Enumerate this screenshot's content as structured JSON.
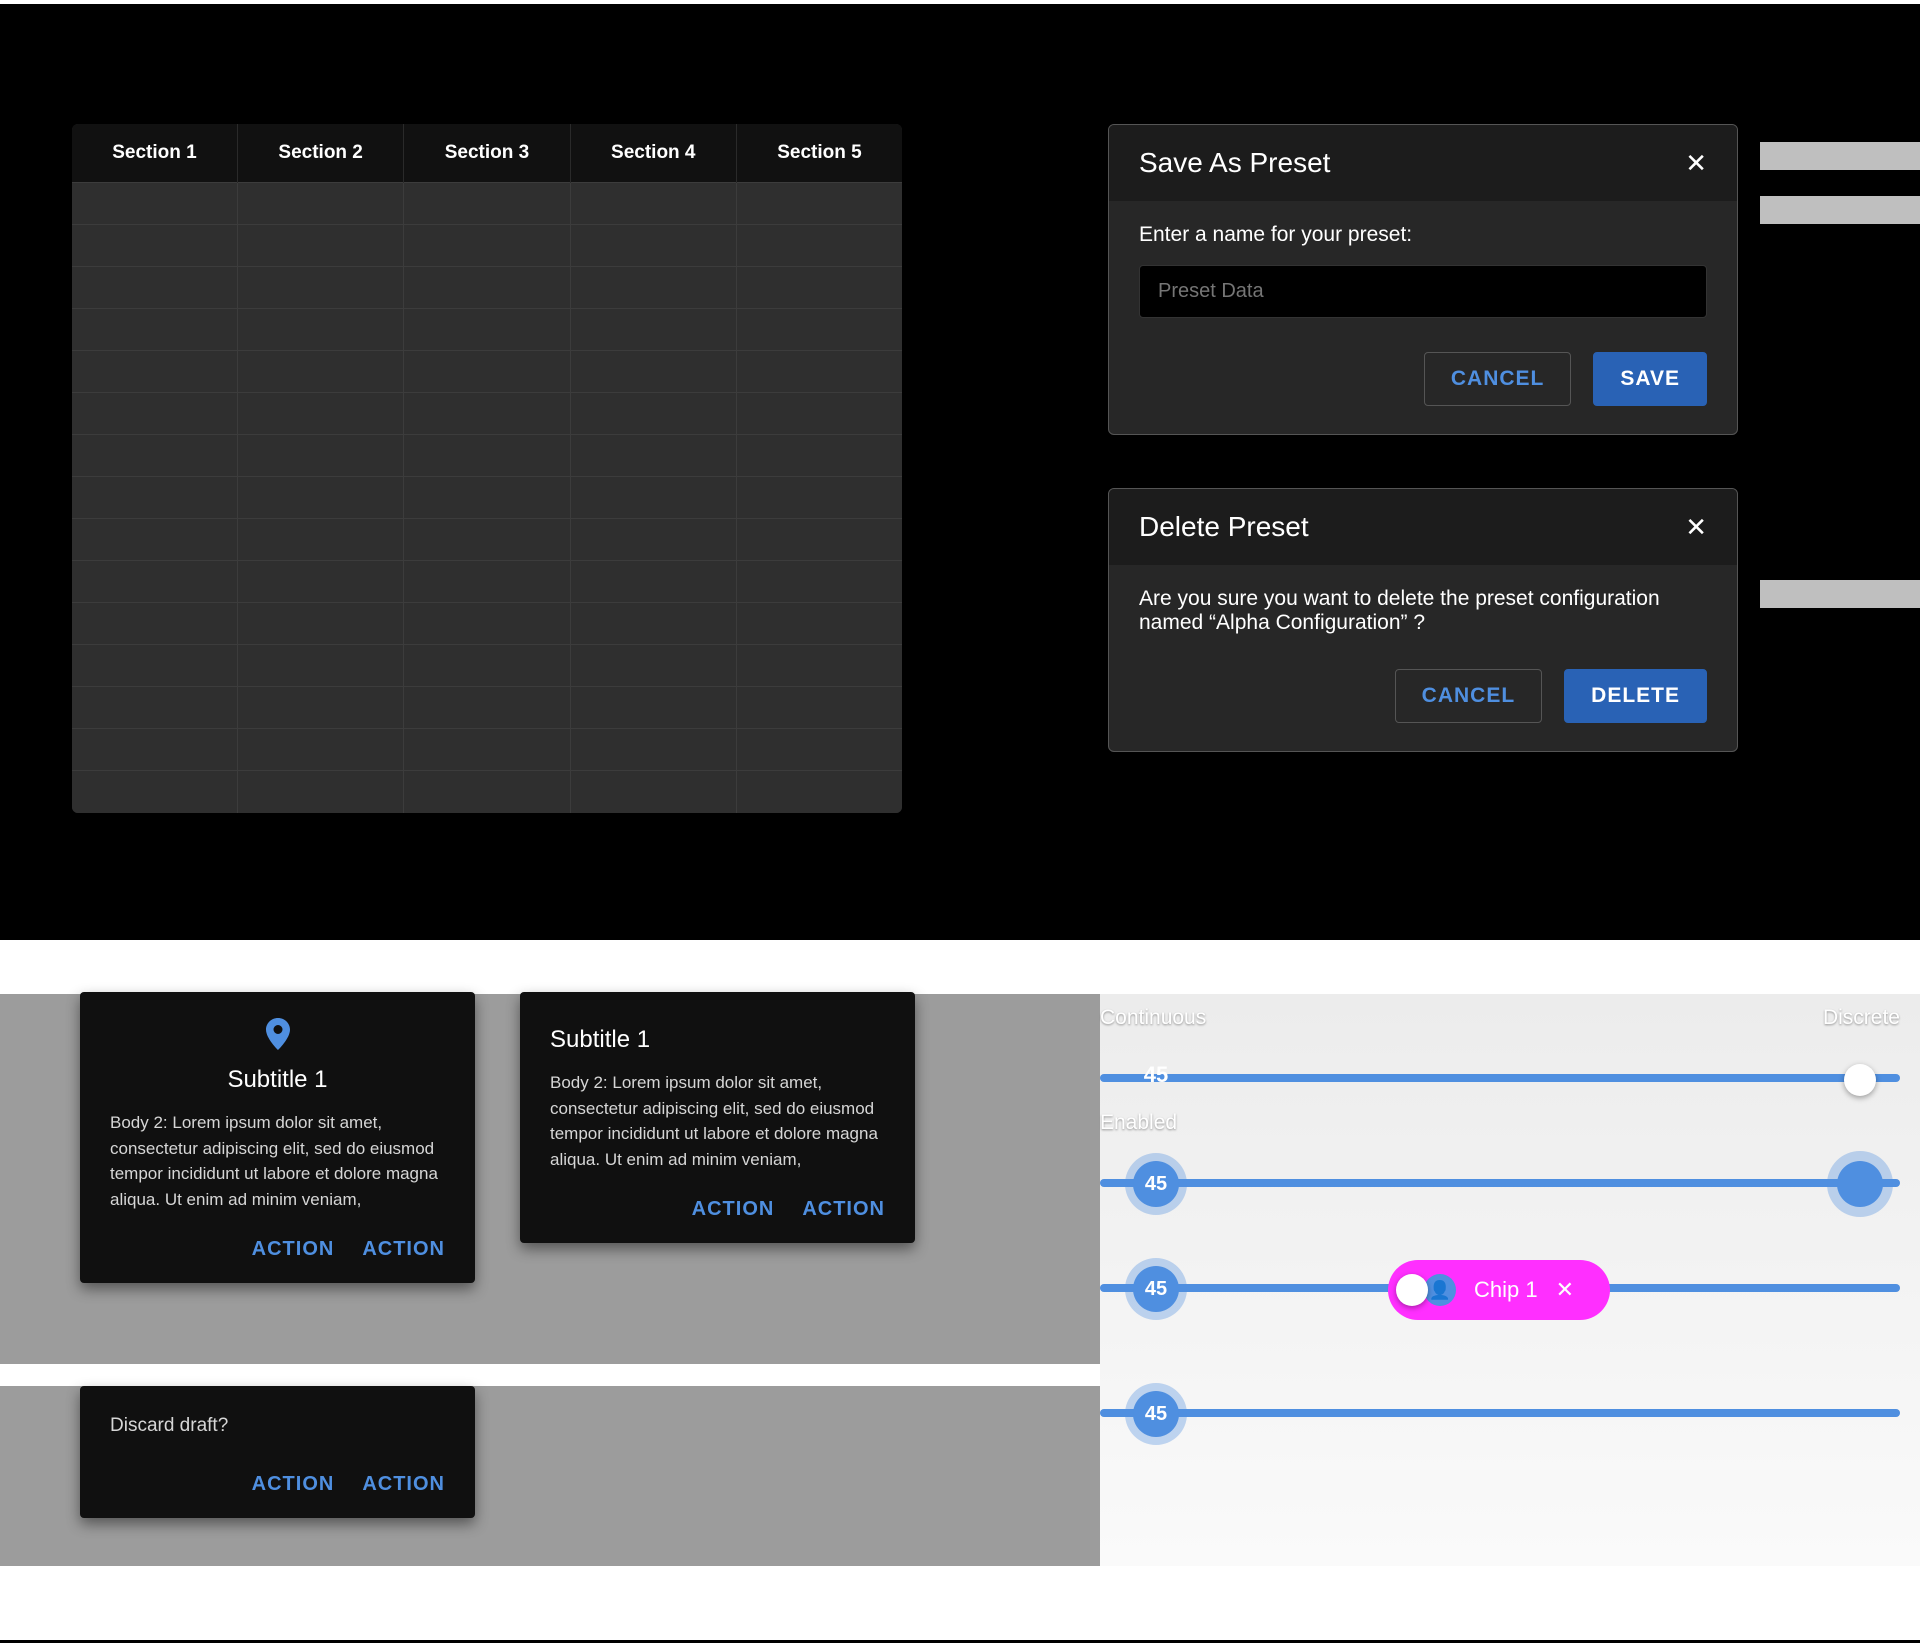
{
  "table": {
    "columns": [
      "Section 1",
      "Section 2",
      "Section 3",
      "Section 4",
      "Section 5"
    ],
    "row_count": 15
  },
  "dialogs": {
    "save": {
      "title": "Save As Preset",
      "prompt": "Enter a name for your preset:",
      "placeholder": "Preset Data",
      "cancel": "CANCEL",
      "confirm": "SAVE"
    },
    "delete": {
      "title": "Delete Preset",
      "message": "Are you sure you want to delete the preset configuration named “Alpha Configuration” ?",
      "cancel": "CANCEL",
      "confirm": "DELETE"
    }
  },
  "cards": {
    "a": {
      "subtitle": "Subtitle 1",
      "body": "Body 2: Lorem ipsum dolor sit amet, consectetur adipiscing elit, sed do eiusmod tempor incididunt ut labore et dolore magna aliqua. Ut enim ad minim veniam,",
      "action1": "ACTION",
      "action2": "ACTION"
    },
    "b": {
      "subtitle": "Subtitle 1",
      "body": "Body 2: Lorem ipsum dolor sit amet, consectetur adipiscing elit, sed do eiusmod tempor incididunt ut labore et dolore magna aliqua. Ut enim ad minim veniam,",
      "action1": "ACTION",
      "action2": "ACTION"
    },
    "c": {
      "body": "Discard draft?",
      "action1": "ACTION",
      "action2": "ACTION"
    }
  },
  "sliders": {
    "s1": {
      "label_l": "Continuous",
      "label_r": "Discrete",
      "value": 45,
      "percent": 7
    },
    "s2": {
      "label_l": "Enabled",
      "value": 45,
      "percent": 7,
      "thumb_big_percent": 95
    },
    "s3": {
      "value": 45,
      "percent": 7,
      "chip_label": "Chip 1",
      "chip_thumb_percent": 39
    },
    "s4": {
      "value": 45,
      "percent": 7
    }
  },
  "chips": {
    "c1": {
      "label": "Chip 1"
    }
  },
  "colors": {
    "blue": "#4f8fe0",
    "magenta": "#ff2fff"
  }
}
